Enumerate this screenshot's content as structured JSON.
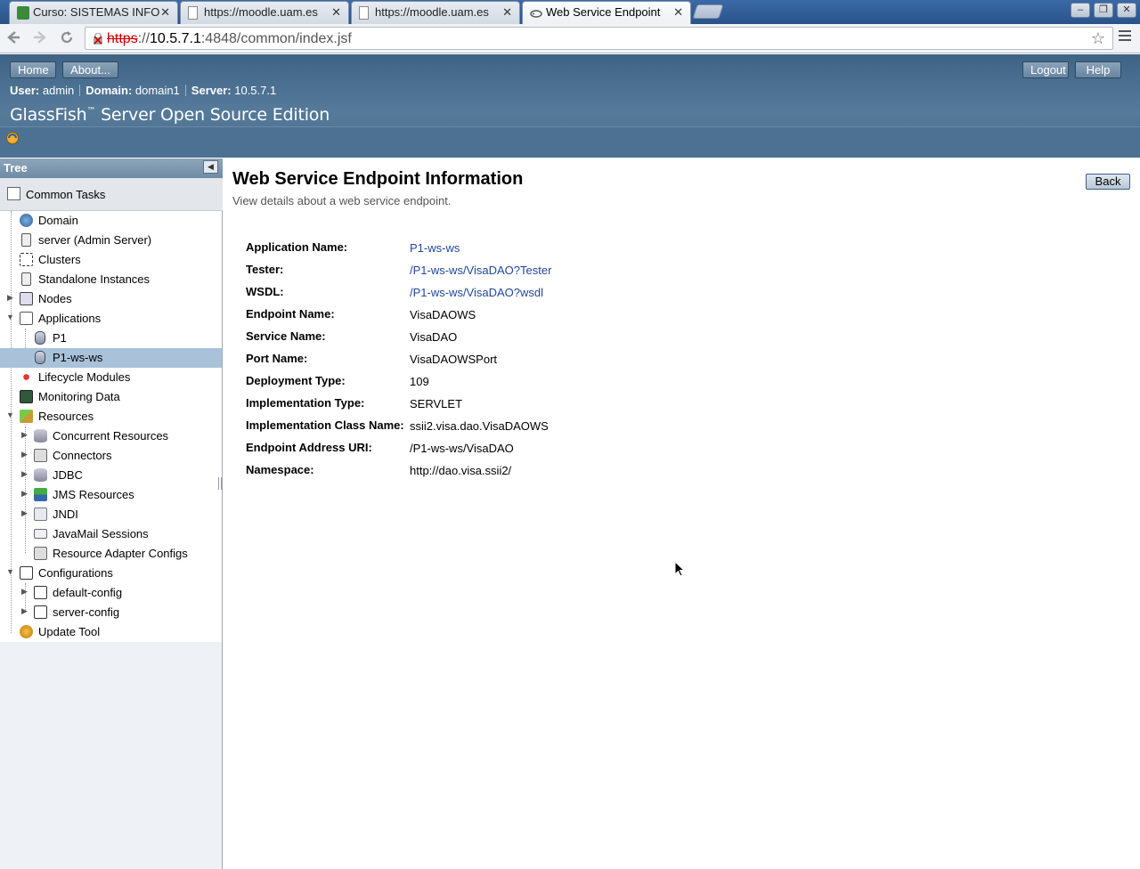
{
  "browser": {
    "tabs": [
      {
        "label": "Curso: SISTEMAS INFO",
        "icon": "moodle-course-icon",
        "active": false
      },
      {
        "label": "https://moodle.uam.es",
        "icon": "page-icon",
        "active": false
      },
      {
        "label": "https://moodle.uam.es",
        "icon": "page-icon",
        "active": false
      },
      {
        "label": "Web Service Endpoint",
        "icon": "glassfish-icon",
        "active": true
      }
    ],
    "url_scheme": "https",
    "url_sep": "://",
    "url_host": "10.5.7.1",
    "url_rest": ":4848/common/index.jsf",
    "close_glyph": "✕",
    "win_min": "‒",
    "win_max": "❐",
    "win_close": "✕"
  },
  "header": {
    "home_label": "Home",
    "about_label": "About...",
    "logout_label": "Logout",
    "help_label": "Help",
    "user_label": "User:",
    "user_value": "admin",
    "domain_label": "Domain:",
    "domain_value": "domain1",
    "server_label": "Server:",
    "server_value": "10.5.7.1",
    "product_name": "GlassFish",
    "product_tm": "™",
    "product_rest": " Server Open Source Edition"
  },
  "tree": {
    "title": "Tree",
    "collapse_glyph": "◀",
    "common_tasks": "Common Tasks",
    "nodes": [
      {
        "label": "Domain",
        "icon": "domain-icon"
      },
      {
        "label": "server (Admin Server)",
        "icon": "server-icon"
      },
      {
        "label": "Clusters",
        "icon": "clusters-icon"
      },
      {
        "label": "Standalone Instances",
        "icon": "instances-icon"
      },
      {
        "label": "Nodes",
        "icon": "nodes-icon"
      },
      {
        "label": "Applications",
        "icon": "applications-icon"
      },
      {
        "label": "P1",
        "icon": "application-icon"
      },
      {
        "label": "P1-ws-ws",
        "icon": "application-icon"
      },
      {
        "label": "Lifecycle Modules",
        "icon": "lifecycle-icon"
      },
      {
        "label": "Monitoring Data",
        "icon": "monitoring-icon"
      },
      {
        "label": "Resources",
        "icon": "resources-icon"
      },
      {
        "label": "Concurrent Resources",
        "icon": "database-icon"
      },
      {
        "label": "Connectors",
        "icon": "connector-icon"
      },
      {
        "label": "JDBC",
        "icon": "database-icon"
      },
      {
        "label": "JMS Resources",
        "icon": "jms-icon"
      },
      {
        "label": "JNDI",
        "icon": "jndi-icon"
      },
      {
        "label": "JavaMail Sessions",
        "icon": "mail-icon"
      },
      {
        "label": "Resource Adapter Configs",
        "icon": "connector-icon"
      },
      {
        "label": "Configurations",
        "icon": "config-icon"
      },
      {
        "label": "default-config",
        "icon": "config-icon"
      },
      {
        "label": "server-config",
        "icon": "config-icon"
      },
      {
        "label": "Update Tool",
        "icon": "update-tool-icon"
      }
    ]
  },
  "main": {
    "title": "Web Service Endpoint Information",
    "help": "View details about a web service endpoint.",
    "back_label": "Back",
    "properties": [
      {
        "label": "Application Name:",
        "value": "P1-ws-ws",
        "link": true
      },
      {
        "label": "Tester:",
        "value": "/P1-ws-ws/VisaDAO?Tester",
        "link": true
      },
      {
        "label": "WSDL:",
        "value": "/P1-ws-ws/VisaDAO?wsdl",
        "link": true
      },
      {
        "label": "Endpoint Name:",
        "value": "VisaDAOWS",
        "link": false
      },
      {
        "label": "Service Name:",
        "value": "VisaDAO",
        "link": false
      },
      {
        "label": "Port Name:",
        "value": "VisaDAOWSPort",
        "link": false
      },
      {
        "label": "Deployment Type:",
        "value": "109",
        "link": false
      },
      {
        "label": "Implementation Type:",
        "value": "SERVLET",
        "link": false
      },
      {
        "label": "Implementation Class Name:",
        "value": "ssii2.visa.dao.VisaDAOWS",
        "link": false
      },
      {
        "label": "Endpoint Address URI:",
        "value": "/P1-ws-ws/VisaDAO",
        "link": false
      },
      {
        "label": "Namespace:",
        "value": "http://dao.visa.ssii2/",
        "link": false
      }
    ]
  },
  "colors": {
    "header_bg": "#4f7292",
    "link": "#21479a",
    "selected_row": "#a9c2da"
  }
}
